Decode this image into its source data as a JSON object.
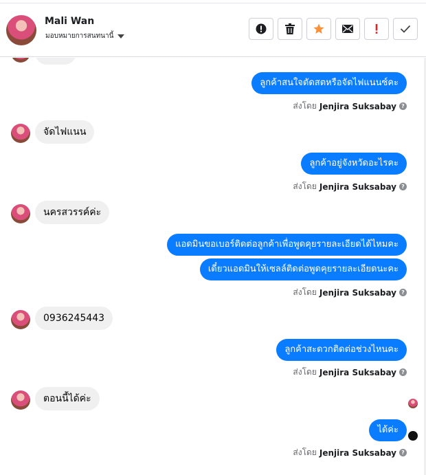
{
  "header": {
    "name": "Mali Wan",
    "assign_label": "มอบหมายการสนทนานี้"
  },
  "toolbar": [
    {
      "name": "alert-button",
      "icon": "alert-icon"
    },
    {
      "name": "delete-button",
      "icon": "trash-icon"
    },
    {
      "name": "star-button",
      "icon": "star-icon",
      "color": "#f7923b"
    },
    {
      "name": "mail-button",
      "icon": "mail-icon"
    },
    {
      "name": "important-button",
      "icon": "exclamation-icon",
      "color": "#e02424"
    },
    {
      "name": "done-button",
      "icon": "check-icon"
    }
  ],
  "sent_by_prefix": "ส่งโดย",
  "sent_by_name": "Jenjira Suksabay",
  "messages": [
    {
      "from": "page",
      "text": "ลูกค้าสนใจตัดสตหรือจัดไฟแนนซ์คะ"
    },
    {
      "from": "user",
      "text": "จัดไฟแนน"
    },
    {
      "from": "page",
      "text": "ลูกค้าอยู่จังหวัดอะไรคะ"
    },
    {
      "from": "user",
      "text": "นครสวรรค์ค่ะ"
    },
    {
      "from": "page",
      "text": "แอดมินขอเบอร์ติดต่อลูกค้าเพื่อพูดคุยรายละเอียดได้ไหมคะ"
    },
    {
      "from": "page",
      "text": "เดี๋ยวแอดมินให้เซลล์ติดต่อพูดคุยรายละเอียดนะคะ"
    },
    {
      "from": "user",
      "text": "0936245443"
    },
    {
      "from": "page",
      "text": "ลูกค้าสะดวกติดต่อช่วงไหนคะ"
    },
    {
      "from": "user",
      "text": "ตอนนี้ได้ค่ะ"
    },
    {
      "from": "page",
      "text": "ได้ค่ะ"
    }
  ],
  "colors": {
    "outgoing": "#0a7cff",
    "incoming": "#f0f0f0"
  }
}
